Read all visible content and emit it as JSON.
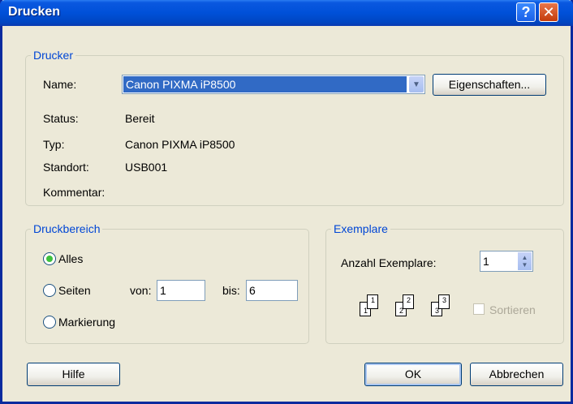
{
  "window": {
    "title": "Drucken",
    "help_icon": "?",
    "close_icon": "✕"
  },
  "printer": {
    "group_title": "Drucker",
    "name_label": "Name:",
    "name_value": "Canon PIXMA iP8500",
    "properties_button": "Eigenschaften...",
    "status_label": "Status:",
    "status_value": "Bereit",
    "type_label": "Typ:",
    "type_value": "Canon PIXMA iP8500",
    "location_label": "Standort:",
    "location_value": "USB001",
    "comment_label": "Kommentar:"
  },
  "range": {
    "group_title": "Druckbereich",
    "all_label": "Alles",
    "pages_label": "Seiten",
    "selection_label": "Markierung",
    "from_label": "von:",
    "from_value": "1",
    "to_label": "bis:",
    "to_value": "6"
  },
  "copies": {
    "group_title": "Exemplare",
    "count_label": "Anzahl Exemplare:",
    "count_value": "1",
    "collate_label": "Sortieren",
    "collate_pages": [
      "1",
      "1",
      "2",
      "2",
      "3",
      "3"
    ]
  },
  "buttons": {
    "help": "Hilfe",
    "ok": "OK",
    "cancel": "Abbrechen"
  }
}
